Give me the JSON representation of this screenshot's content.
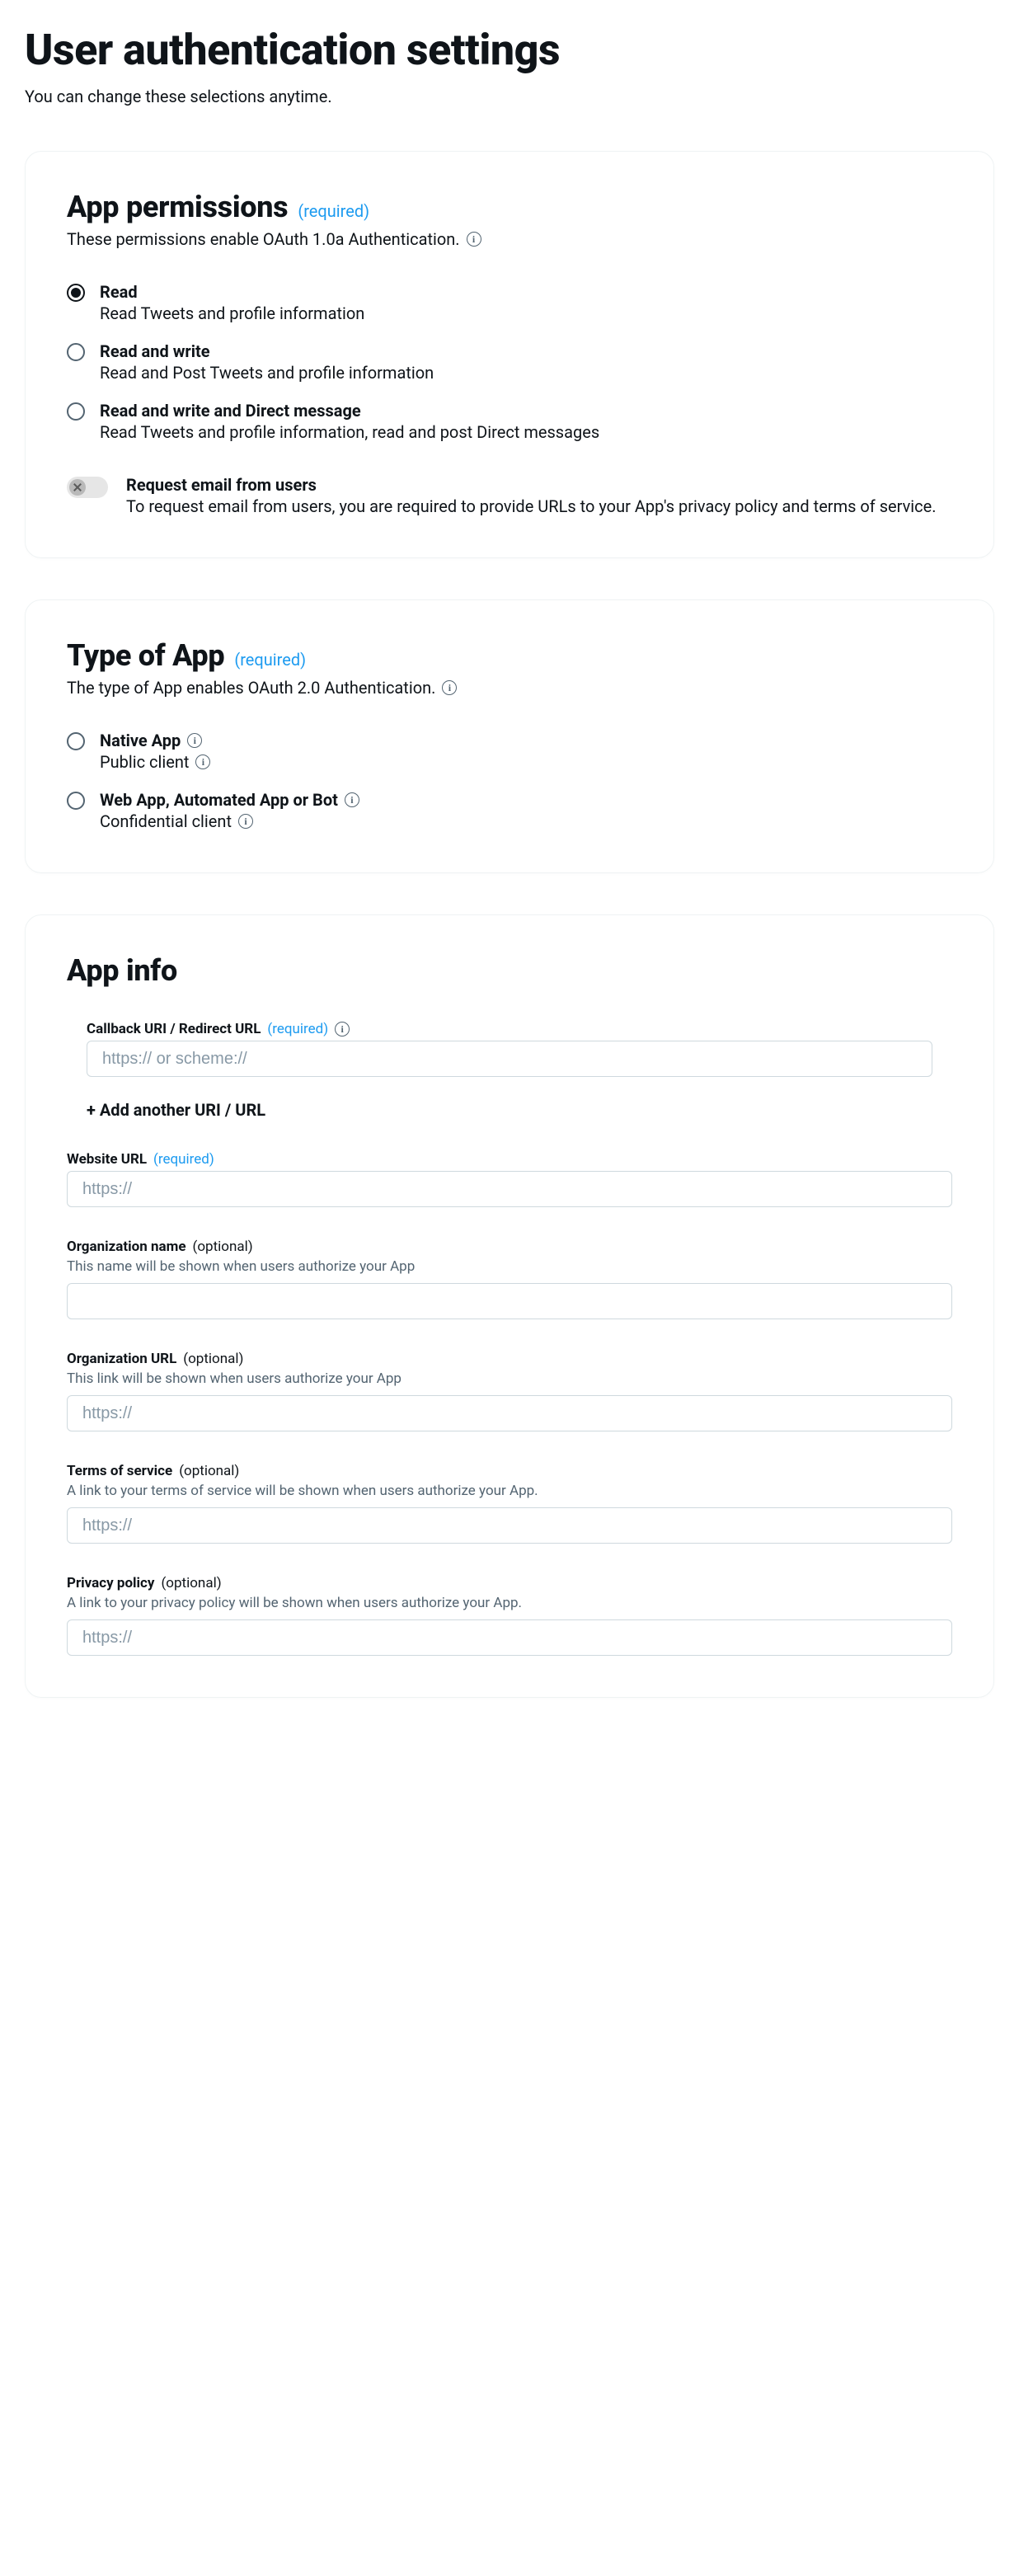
{
  "page": {
    "title": "User authentication settings",
    "subtitle": "You can change these selections anytime."
  },
  "permissions": {
    "title": "App permissions",
    "required": "(required)",
    "desc": "These permissions enable OAuth 1.0a Authentication.",
    "options": [
      {
        "label": "Read",
        "sub": "Read Tweets and profile information",
        "selected": true
      },
      {
        "label": "Read and write",
        "sub": "Read and Post Tweets and profile information",
        "selected": false
      },
      {
        "label": "Read and write and Direct message",
        "sub": "Read Tweets and profile information, read and post Direct messages",
        "selected": false
      }
    ],
    "email_toggle": {
      "label": "Request email from users",
      "desc": "To request email from users, you are required to provide URLs to your App's privacy policy and terms of service.",
      "enabled": false
    }
  },
  "app_type": {
    "title": "Type of App",
    "required": "(required)",
    "desc": "The type of App enables OAuth 2.0 Authentication.",
    "options": [
      {
        "label": "Native App",
        "sub": "Public client",
        "selected": false
      },
      {
        "label": "Web App, Automated App or Bot",
        "sub": "Confidential client",
        "selected": false
      }
    ]
  },
  "app_info": {
    "title": "App info",
    "callback": {
      "label": "Callback URI / Redirect URL",
      "tag": "(required)",
      "placeholder": "https:// or scheme://",
      "add_text": "+ Add another URI / URL"
    },
    "website": {
      "label": "Website URL",
      "tag": "(required)",
      "placeholder": "https://"
    },
    "org_name": {
      "label": "Organization name",
      "tag": "(optional)",
      "help": "This name will be shown when users authorize your App",
      "placeholder": ""
    },
    "org_url": {
      "label": "Organization URL",
      "tag": "(optional)",
      "help": "This link will be shown when users authorize your App",
      "placeholder": "https://"
    },
    "tos": {
      "label": "Terms of service",
      "tag": "(optional)",
      "help": "A link to your terms of service will be shown when users authorize your App.",
      "placeholder": "https://"
    },
    "privacy": {
      "label": "Privacy policy",
      "tag": "(optional)",
      "help": "A link to your privacy policy will be shown when users authorize your App.",
      "placeholder": "https://"
    }
  }
}
